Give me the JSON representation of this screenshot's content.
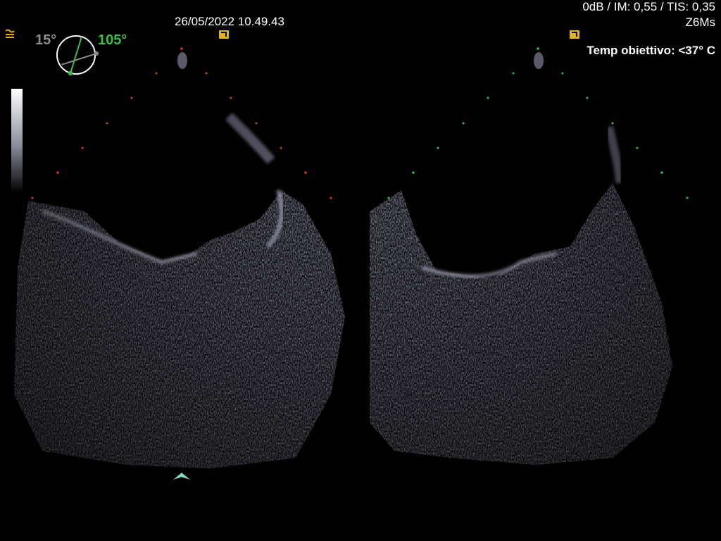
{
  "header": {
    "datetime": "26/05/2022 10.49.43",
    "status": "0dB / IM: 0,55 / TIS: 0,35",
    "probe": "Z6Ms",
    "temperature": "Temp obiettivo: <37° C"
  },
  "angles": {
    "secondary": "15°",
    "primary": "105°"
  },
  "colors": {
    "primary_angle": "#3bbf4a",
    "secondary_angle": "#8c8c8c",
    "marker_left": "#d83a2a",
    "marker_right": "#36c24a",
    "orientation_marker": "#e2b21e",
    "depth_caret": "#7fe0c0"
  },
  "icons": [
    "menu-lines-icon",
    "probe-orientation-icon",
    "plane-dial-icon",
    "depth-caret-icon"
  ]
}
